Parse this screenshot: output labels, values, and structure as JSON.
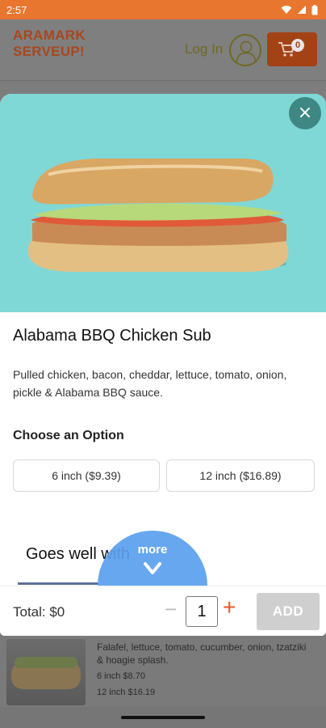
{
  "status_bar": {
    "time": "2:57"
  },
  "header": {
    "brand_line1": "ARAMARK",
    "brand_line2": "SERVEUP!",
    "login_label": "Log In",
    "cart_count": "0"
  },
  "modal": {
    "close_glyph": "×",
    "title": "Alabama BBQ Chicken Sub",
    "description": "Pulled chicken, bacon, cheddar, lettuce, tomato, onion, pickle & Alabama BBQ sauce.",
    "option_heading": "Choose an Option",
    "options": [
      {
        "label": "6 inch  ($9.39)"
      },
      {
        "label": "12 inch  ($16.89)"
      }
    ],
    "goes_well_heading": "Goes well with",
    "more_label": "more"
  },
  "footer": {
    "total_label": "Total: $0",
    "minus_glyph": "−",
    "quantity": "1",
    "plus_glyph": "+",
    "add_label": "ADD"
  },
  "background_item": {
    "description": "Falafel, lettuce, tomato, cucumber, onion, tzatziki & hoagie splash.",
    "price_6": "6 inch $8.70",
    "price_12": "12 inch $16.19"
  },
  "colors": {
    "status_bar": "#e8762f",
    "brand": "#a8471e",
    "hero_bg": "#7fd8d6",
    "close_btn": "#3f8782",
    "more_btn": "#5aa0ee",
    "plus_accent": "#e8562a",
    "add_disabled": "#cfcfcf"
  },
  "icons": {
    "status": [
      "wifi-icon",
      "signal-icon",
      "battery-icon"
    ],
    "header": [
      "user-avatar-icon",
      "cart-icon"
    ],
    "modal": [
      "close-icon",
      "chevron-down-icon"
    ]
  }
}
